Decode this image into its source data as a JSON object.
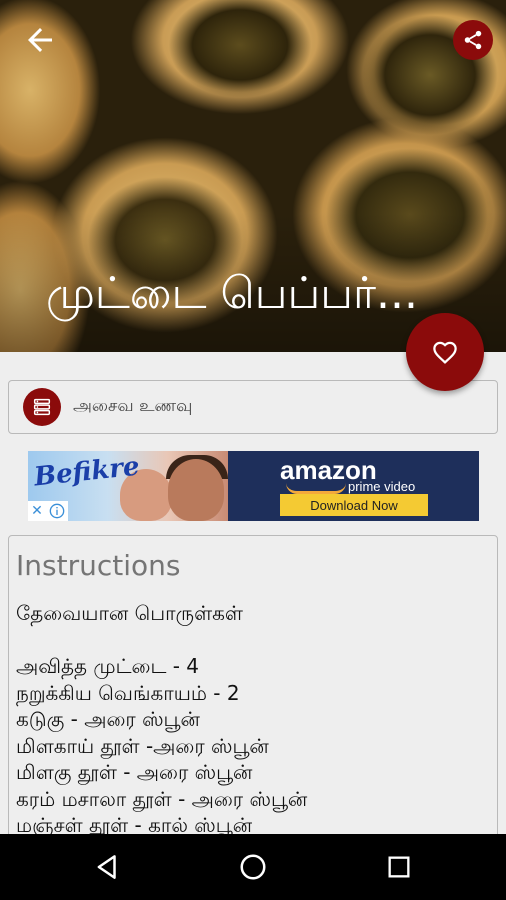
{
  "header": {
    "title": "முட்டை பெப்பர்...",
    "back_icon": "arrow-back-icon",
    "share_icon": "share-icon"
  },
  "favorite": {
    "icon": "heart-outline-icon"
  },
  "category": {
    "icon": "list-icon",
    "label": "அசைவ உணவு"
  },
  "ad": {
    "brand": "Befikre",
    "advertiser": "amazon",
    "product": "prime video",
    "cta": "Download Now",
    "close_label": "✕"
  },
  "instructions": {
    "heading": "Instructions",
    "lines": [
      "தேவையான பொருள்கள்",
      "",
      "அவித்த முட்டை - 4",
      "நறுக்கிய  வெங்காயம் - 2",
      "கடுகு - அரை ஸ்பூன்",
      "மிளகாய் தூள் -அரை  ஸ்பூன்",
      "மிளகு தூள் - அரை ஸ்பூன்",
      "கரம் மசாலா தூள் - அரை ஸ்பூன்",
      "மஞ்சள் தூள் - கால் ஸ்பூன்"
    ]
  },
  "colors": {
    "accent": "#8b0b0b",
    "background": "#eeeeee",
    "navbar": "#000000"
  },
  "navbar": {
    "back_icon": "nav-back-icon",
    "home_icon": "nav-home-icon",
    "recents_icon": "nav-recents-icon"
  }
}
